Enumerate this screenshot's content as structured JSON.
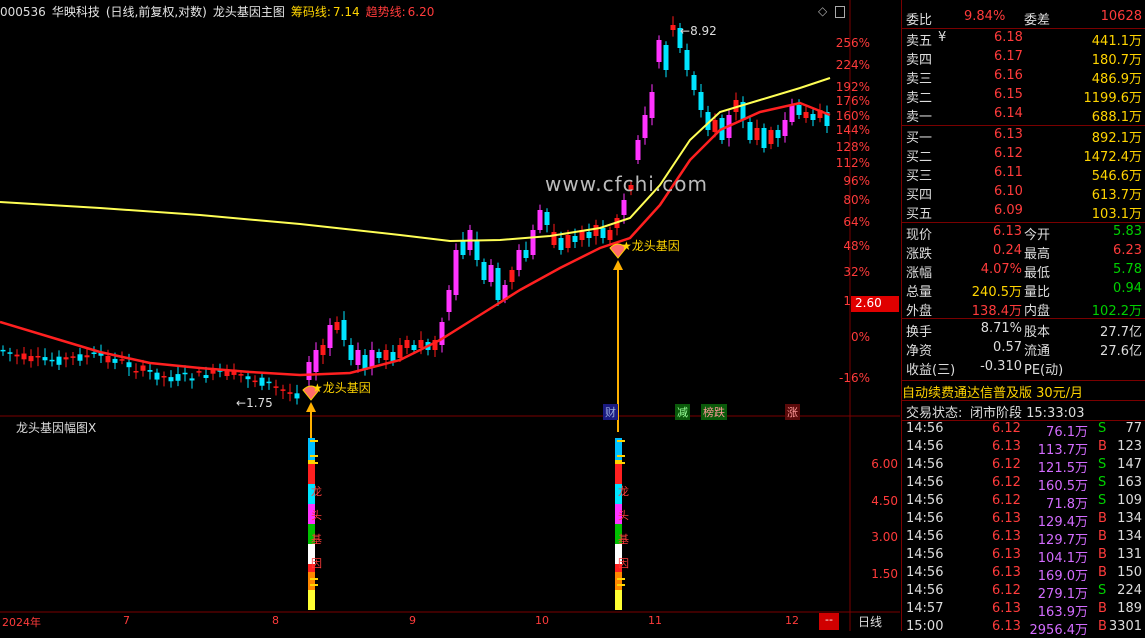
{
  "header": {
    "code": "000536",
    "name": "华映科技",
    "period": "(日线,前复权,对数)",
    "indicator": "龙头基因主图",
    "chip_label": "筹码线:",
    "chip_value": "7.14",
    "trend_label": "趋势线:",
    "trend_value": "6.20"
  },
  "subchart": {
    "title": "龙头基因幅图X"
  },
  "watermark": "www.cfchi.com",
  "main_axis": {
    "labels": [
      "256%",
      "224%",
      "192%",
      "176%",
      "160%",
      "144%",
      "128%",
      "112%",
      "96%",
      "80%",
      "64%",
      "48%",
      "32%",
      "16%",
      "0%",
      "-16%"
    ],
    "price_tag": "2.60"
  },
  "sub_axis": {
    "labels": [
      "6.00",
      "4.50",
      "3.00",
      "1.50"
    ]
  },
  "x_axis": {
    "labels": [
      "2024年",
      "7",
      "8",
      "9",
      "10",
      "11",
      "12"
    ],
    "period_button": "日线",
    "minus_button": "--"
  },
  "annotations": {
    "high_price": "8.92",
    "low_price": "1.75",
    "signal1": "龙头基因",
    "signal2": "龙头基因",
    "signal_icon": "★"
  },
  "event_markers": [
    "财",
    "减",
    "榜跌",
    "涨"
  ],
  "sub_bar_text": [
    "龙",
    "头",
    "基",
    "因"
  ],
  "quote": {
    "weibi_label": "委比",
    "weibi": "9.84%",
    "weicha_label": "委差",
    "weicha": "10628",
    "asks": [
      {
        "label": "卖五",
        "mark": "¥",
        "price": "6.18",
        "vol": "441.1万"
      },
      {
        "label": "卖四",
        "price": "6.17",
        "vol": "180.7万"
      },
      {
        "label": "卖三",
        "price": "6.16",
        "vol": "486.9万"
      },
      {
        "label": "卖二",
        "price": "6.15",
        "vol": "1199.6万"
      },
      {
        "label": "卖一",
        "price": "6.14",
        "vol": "688.1万"
      }
    ],
    "bids": [
      {
        "label": "买一",
        "price": "6.13",
        "vol": "892.1万"
      },
      {
        "label": "买二",
        "price": "6.12",
        "vol": "1472.4万"
      },
      {
        "label": "买三",
        "price": "6.11",
        "vol": "546.6万"
      },
      {
        "label": "买四",
        "price": "6.10",
        "vol": "613.7万"
      },
      {
        "label": "买五",
        "price": "6.09",
        "vol": "103.1万"
      }
    ],
    "stats": [
      {
        "l1": "现价",
        "v1": "6.13",
        "l2": "今开",
        "v2": "5.83"
      },
      {
        "l1": "涨跌",
        "v1": "0.24",
        "l2": "最高",
        "v2": "6.23"
      },
      {
        "l1": "涨幅",
        "v1": "4.07%",
        "l2": "最低",
        "v2": "5.78"
      },
      {
        "l1": "总量",
        "v1": "240.5万",
        "l2": "量比",
        "v2": "0.94"
      },
      {
        "l1": "外盘",
        "v1": "138.4万",
        "l2": "内盘",
        "v2": "102.2万"
      }
    ],
    "fund": [
      {
        "l1": "换手",
        "v1": "8.71%",
        "l2": "股本",
        "v2": "27.7亿"
      },
      {
        "l1": "净资",
        "v1": "0.57",
        "l2": "流通",
        "v2": "27.6亿"
      },
      {
        "l1": "收益(三)",
        "v1": "-0.310",
        "l2": "PE(动)",
        "v2": ""
      }
    ],
    "ad_text": "自动续费通达信普及版 30元/月",
    "status_label": "交易状态:",
    "status_value": "闭市阶段 15:33:03"
  },
  "ticks": [
    {
      "t": "14:56",
      "p": "6.12",
      "v": "76.1万",
      "d": "S",
      "n": "77"
    },
    {
      "t": "14:56",
      "p": "6.13",
      "v": "113.7万",
      "d": "B",
      "n": "123"
    },
    {
      "t": "14:56",
      "p": "6.12",
      "v": "121.5万",
      "d": "S",
      "n": "147"
    },
    {
      "t": "14:56",
      "p": "6.12",
      "v": "160.5万",
      "d": "S",
      "n": "163"
    },
    {
      "t": "14:56",
      "p": "6.12",
      "v": "71.8万",
      "d": "S",
      "n": "109"
    },
    {
      "t": "14:56",
      "p": "6.13",
      "v": "129.4万",
      "d": "B",
      "n": "134"
    },
    {
      "t": "14:56",
      "p": "6.13",
      "v": "129.7万",
      "d": "B",
      "n": "134"
    },
    {
      "t": "14:56",
      "p": "6.13",
      "v": "104.1万",
      "d": "B",
      "n": "131"
    },
    {
      "t": "14:56",
      "p": "6.13",
      "v": "169.0万",
      "d": "B",
      "n": "150"
    },
    {
      "t": "14:56",
      "p": "6.12",
      "v": "279.1万",
      "d": "S",
      "n": "224"
    },
    {
      "t": "14:57",
      "p": "6.13",
      "v": "163.9万",
      "d": "B",
      "n": "189"
    },
    {
      "t": "15:00",
      "p": "6.13",
      "v": "2956.4万",
      "d": "B",
      "n": "3301"
    }
  ],
  "colors": {
    "up": "#ff33ff",
    "up_big": "#ff1a1a",
    "down": "#00e5ff",
    "trend": "#ff2020",
    "chip": "#ffff55",
    "axis": "#7a0000",
    "arrow": "#ffb000"
  }
}
